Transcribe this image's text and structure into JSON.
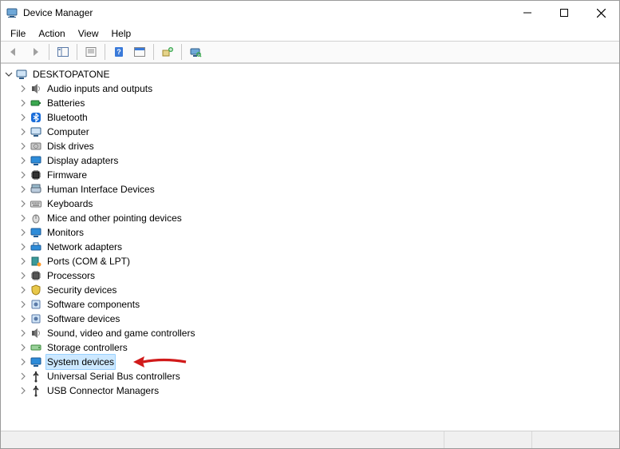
{
  "window": {
    "title": "Device Manager"
  },
  "menu": {
    "file": "File",
    "action": "Action",
    "view": "View",
    "help": "Help"
  },
  "tree": {
    "root": {
      "label": "DESKTOPATONE",
      "expanded": true
    },
    "items": [
      {
        "label": "Audio inputs and outputs",
        "icon": "speaker"
      },
      {
        "label": "Batteries",
        "icon": "battery"
      },
      {
        "label": "Bluetooth",
        "icon": "bluetooth"
      },
      {
        "label": "Computer",
        "icon": "monitor"
      },
      {
        "label": "Disk drives",
        "icon": "disk"
      },
      {
        "label": "Display adapters",
        "icon": "monitor-blue"
      },
      {
        "label": "Firmware",
        "icon": "chip-dark"
      },
      {
        "label": "Human Interface Devices",
        "icon": "hid"
      },
      {
        "label": "Keyboards",
        "icon": "keyboard"
      },
      {
        "label": "Mice and other pointing devices",
        "icon": "mouse"
      },
      {
        "label": "Monitors",
        "icon": "monitor-blue"
      },
      {
        "label": "Network adapters",
        "icon": "network"
      },
      {
        "label": "Ports (COM & LPT)",
        "icon": "port"
      },
      {
        "label": "Processors",
        "icon": "chip"
      },
      {
        "label": "Security devices",
        "icon": "shield"
      },
      {
        "label": "Software components",
        "icon": "software"
      },
      {
        "label": "Software devices",
        "icon": "software"
      },
      {
        "label": "Sound, video and game controllers",
        "icon": "speaker"
      },
      {
        "label": "Storage controllers",
        "icon": "storage"
      },
      {
        "label": "System devices",
        "icon": "system",
        "selected": true
      },
      {
        "label": "Universal Serial Bus controllers",
        "icon": "usb"
      },
      {
        "label": "USB Connector Managers",
        "icon": "usb"
      }
    ]
  },
  "annotation": {
    "arrow_points_at": "System devices"
  },
  "colors": {
    "selection_bg": "#cce8ff",
    "selection_border": "#99d1ff",
    "toolbar_border": "#d0d0d0",
    "arrow": "#d11a1a"
  }
}
